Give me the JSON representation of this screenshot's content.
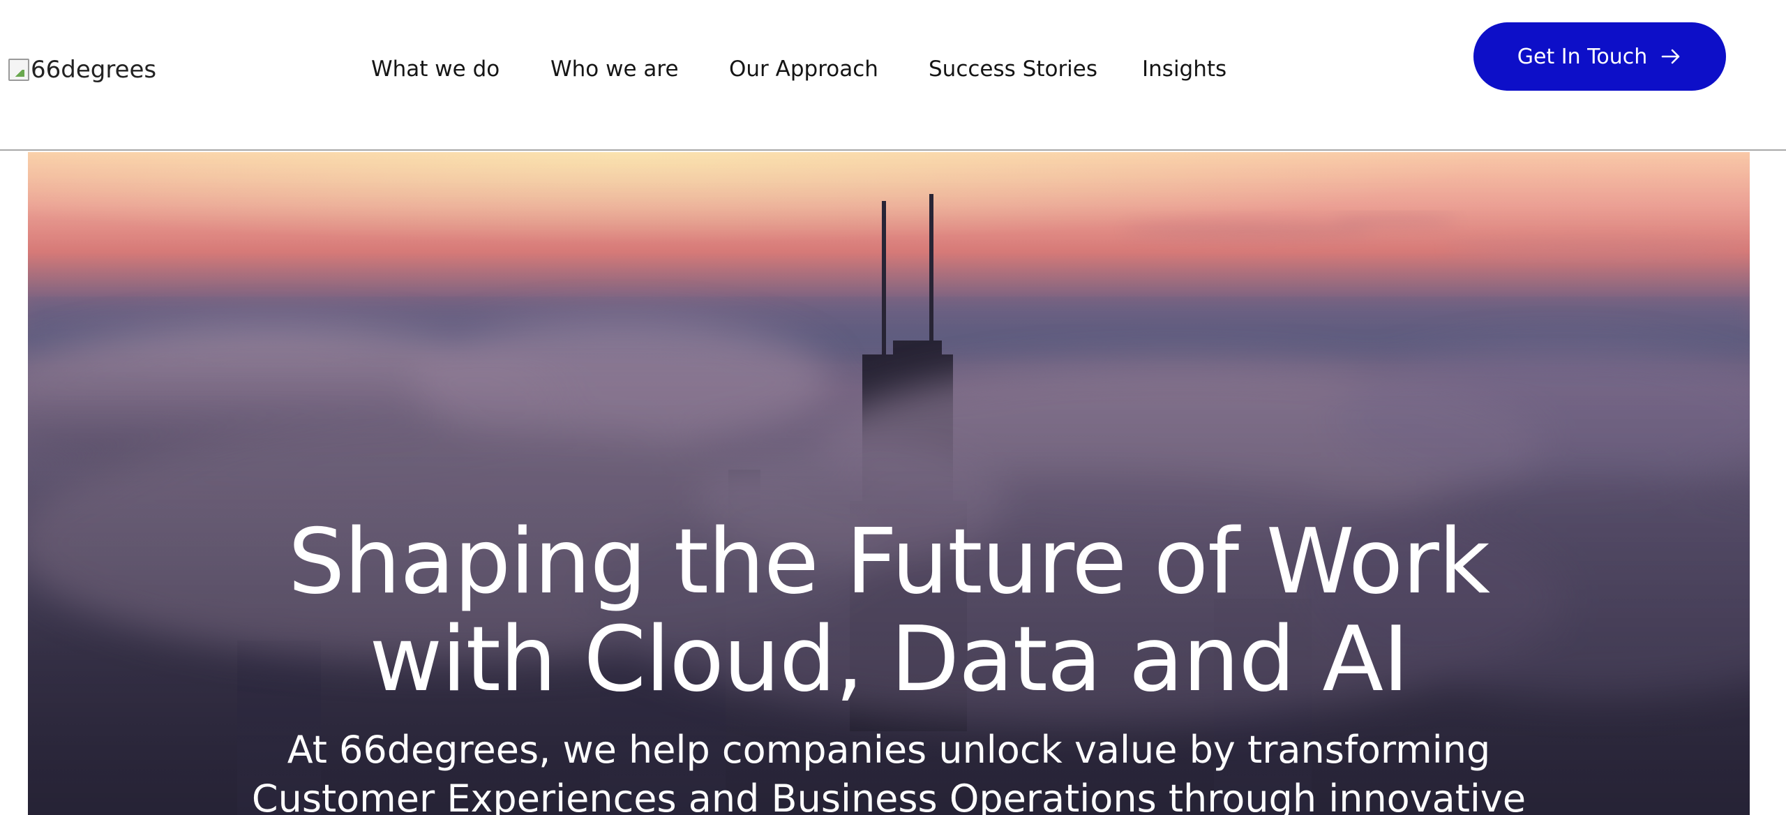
{
  "header": {
    "logo_alt": "66degrees",
    "nav": [
      {
        "label": "What we do"
      },
      {
        "label": "Who we are"
      },
      {
        "label": "Our Approach"
      },
      {
        "label": "Success Stories"
      },
      {
        "label": "Insights"
      }
    ],
    "cta_label": "Get In Touch",
    "cta_icon": "arrow-right-icon",
    "cta_color": "#0d0fc8"
  },
  "hero": {
    "title_line1": "Shaping the Future of Work",
    "title_line2": "with Cloud, Data and AI",
    "subtitle_line1": "At 66degrees, we help companies unlock value by transforming",
    "subtitle_line2": "Customer Experiences and Business Operations through innovative"
  }
}
